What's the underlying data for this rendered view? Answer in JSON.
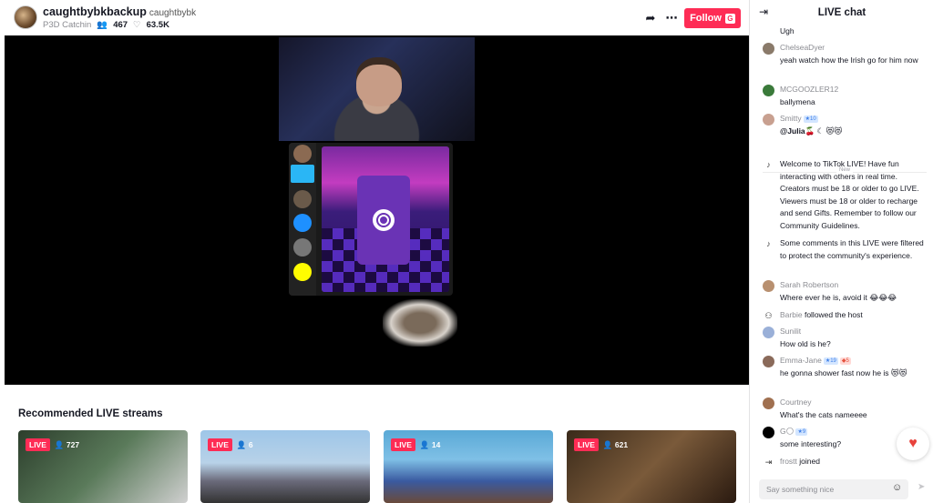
{
  "header": {
    "streamer_name": "caughtbybkbackup",
    "streamer_handle": "caughtbybk",
    "category": "P3D Catchin",
    "viewers": "467",
    "likes": "63.5K",
    "follow_label": "Follow",
    "follow_badge": "G"
  },
  "recommended": {
    "title": "Recommended LIVE streams",
    "cards": [
      {
        "live": "LIVE",
        "count": "727"
      },
      {
        "live": "LIVE",
        "count": "6"
      },
      {
        "live": "LIVE",
        "count": "14"
      },
      {
        "live": "LIVE",
        "count": "621"
      }
    ]
  },
  "chat": {
    "title": "LIVE chat",
    "divider": "New",
    "messages": [
      {
        "user": "",
        "text": "Ugh"
      },
      {
        "user": "ChelseaDyer",
        "text": "yeah watch how the Irish go for him now"
      },
      {
        "user": "MCGOOZLER12",
        "text": "ballymena"
      },
      {
        "user": "Smitty",
        "text": "@Julia🍒 ☾ 😻😻"
      },
      {
        "user": "",
        "text": "Welcome to TikTok LIVE! Have fun interacting with others in real time. Creators must be 18 or older to go LIVE. Viewers must be 18 or older to recharge and send Gifts. Remember to follow our Community Guidelines."
      },
      {
        "user": "",
        "text": "Some comments in this LIVE were filtered to protect the community's experience."
      },
      {
        "user": "Sarah Robertson",
        "text": "Where ever he is, avoid it 😂😂😂"
      },
      {
        "user": "Barbie",
        "text": "followed the host"
      },
      {
        "user": "Sunilit",
        "text": "How old is he?"
      },
      {
        "user": "Emma-Jane",
        "text": "he gonna shower fast now he is 😻😻"
      },
      {
        "user": "Courtney",
        "text": "What's the cats nameeee"
      },
      {
        "user": "G🌕",
        "text": "some interesting?"
      },
      {
        "user": "frostt",
        "text": "joined"
      }
    ],
    "input_placeholder": "Say something nice"
  },
  "colors": {
    "accent": "#fe2c55",
    "video_bg": "#000000"
  }
}
